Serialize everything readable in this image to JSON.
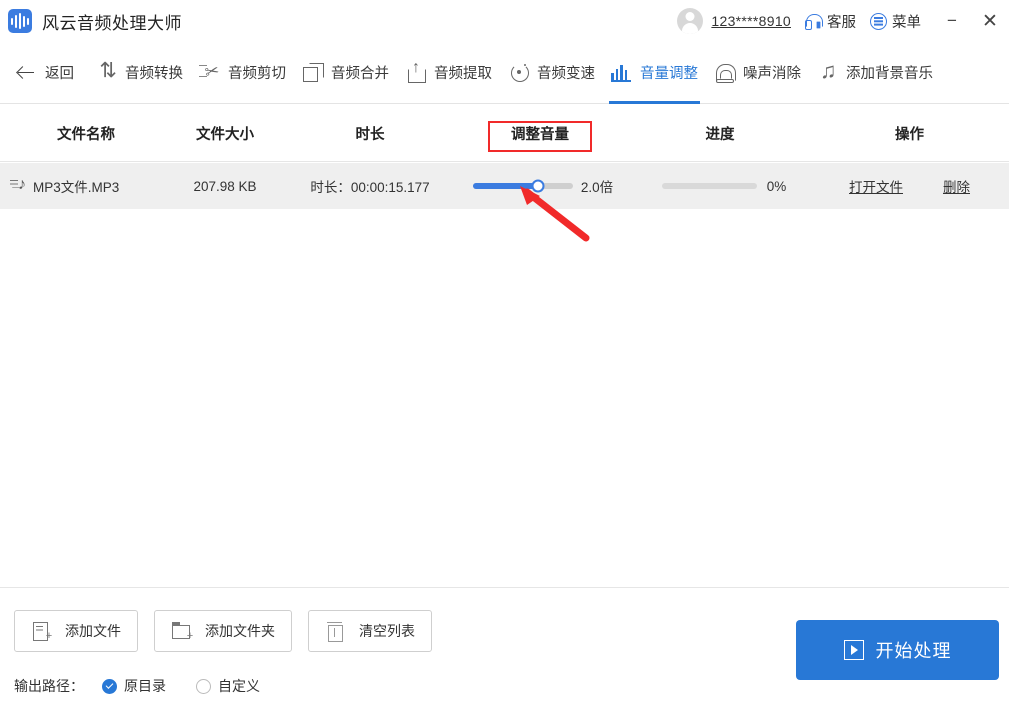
{
  "window": {
    "app_title": "风云音频处理大师",
    "logo_icon": "audio-wave-logo",
    "account": "123****8910",
    "support_label": "客服",
    "support_icon": "headset-icon",
    "menu_label": "菜单",
    "menu_icon": "hamburger-circle-icon",
    "minimize_icon": "−",
    "close_icon": "✕",
    "accent_color": "#2878d6",
    "logo_color": "#3b7ce0"
  },
  "toolbar": {
    "items": [
      {
        "label": "返回",
        "icon": "back-arrow-icon",
        "active": false
      },
      {
        "label": "音频转换",
        "icon": "convert-arrows-icon",
        "active": false
      },
      {
        "label": "音频剪切",
        "icon": "scissors-icon",
        "active": false
      },
      {
        "label": "音频合并",
        "icon": "merge-squares-icon",
        "active": false
      },
      {
        "label": "音频提取",
        "icon": "extract-upload-icon",
        "active": false
      },
      {
        "label": "音频变速",
        "icon": "speed-circle-icon",
        "active": false
      },
      {
        "label": "音量调整",
        "icon": "volume-bars-icon",
        "active": true
      },
      {
        "label": "噪声消除",
        "icon": "noise-wave-icon",
        "active": false
      },
      {
        "label": "添加背景音乐",
        "icon": "music-note-icon",
        "active": false
      }
    ]
  },
  "table": {
    "headers": {
      "name": "文件名称",
      "size": "文件大小",
      "duration": "时长",
      "volume": "调整音量",
      "progress": "进度",
      "action": "操作"
    },
    "rows": [
      {
        "file_icon": "audio-file-icon",
        "name": "MP3文件.MP3",
        "size": "207.98 KB",
        "duration": "时长：00:00:15.177",
        "volume_value": "2.0倍",
        "volume_percent": 65,
        "progress_text": "0%",
        "progress_percent": 0,
        "open_label": "打开文件",
        "delete_label": "删除"
      }
    ]
  },
  "footer": {
    "add_file": "添加文件",
    "add_file_icon": "add-file-icon",
    "add_folder": "添加文件夹",
    "add_folder_icon": "add-folder-icon",
    "clear_list": "清空列表",
    "clear_list_icon": "trash-icon",
    "output_label": "输出路径：",
    "radio_original": "原目录",
    "radio_custom": "自定义",
    "selected_output": "原目录",
    "start_label": "开始处理",
    "start_icon": "play-box-icon"
  },
  "annotations": {
    "highlight_color": "#f12a2a",
    "highlight_target": "调整音量",
    "arrow_target": "volume-slider-thumb"
  }
}
